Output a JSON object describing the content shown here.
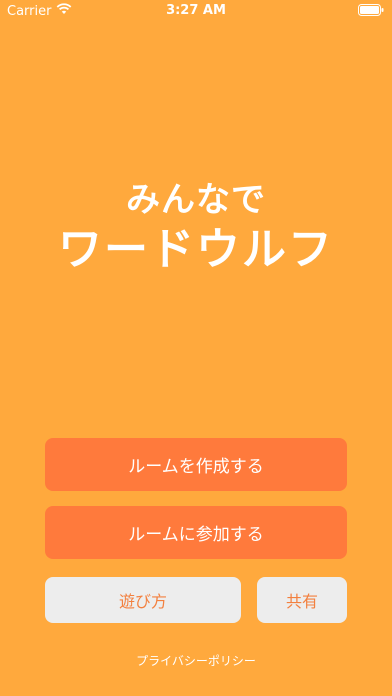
{
  "status_bar": {
    "carrier": "Carrier",
    "time": "3:27 AM",
    "battery_icon": "battery-icon",
    "wifi_icon": "wifi-icon"
  },
  "title": {
    "line1": "みんなで",
    "line2": "ワードウルフ"
  },
  "buttons": {
    "create_room": "ルームを作成する",
    "join_room": "ルームに参加する",
    "how_to_play": "遊び方",
    "share": "共有"
  },
  "privacy_policy": "プライバシーポリシー",
  "colors": {
    "background": "#FFA93D",
    "primary_button": "#FF7A3C",
    "secondary_button": "#EDEDED",
    "secondary_text": "#F3803F"
  }
}
